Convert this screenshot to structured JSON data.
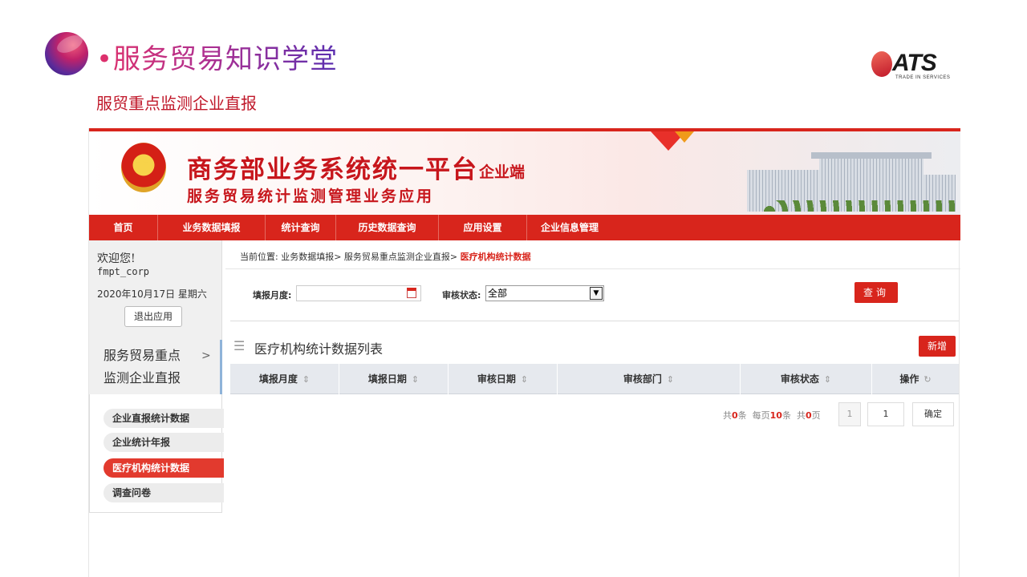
{
  "slide": {
    "title": "•服务贸易知识学堂",
    "subtitle": "服贸重点监测企业直报",
    "logo_text": "ATS",
    "logo_tagline": "TRADE IN SERVICES"
  },
  "banner": {
    "title": "商务部业务系统统一平台",
    "side_label": "企业端",
    "subtitle": "服务贸易统计监测管理业务应用"
  },
  "nav": {
    "items": [
      {
        "label": "首页"
      },
      {
        "label": "业务数据填报"
      },
      {
        "label": "统计查询"
      },
      {
        "label": "历史数据查询"
      },
      {
        "label": "应用设置"
      },
      {
        "label": "企业信息管理"
      }
    ]
  },
  "sidebar": {
    "welcome": "欢迎您!",
    "username": "fmpt_corp",
    "date": "2020年10月17日 星期六",
    "logout_label": "退出应用",
    "module_label": "服务贸易重点监测企业直报",
    "menu": [
      {
        "label": "企业直报统计数据",
        "active": false
      },
      {
        "label": "企业统计年报",
        "active": false
      },
      {
        "label": "医疗机构统计数据",
        "active": true
      },
      {
        "label": "调查问卷",
        "active": false
      }
    ]
  },
  "breadcrumb": {
    "prefix": "当前位置: 业务数据填报> 服务贸易重点监测企业直报>",
    "current": "医疗机构统计数据"
  },
  "filters": {
    "month_label": "填报月度:",
    "month_value": "",
    "status_label": "审核状态:",
    "status_value": "全部",
    "query_label": "查询"
  },
  "list": {
    "title": "医疗机构统计数据列表",
    "add_label": "新增",
    "columns": [
      {
        "label": "填报月度"
      },
      {
        "label": "填报日期"
      },
      {
        "label": "审核日期"
      },
      {
        "label": "审核部门"
      },
      {
        "label": "审核状态"
      },
      {
        "label": "操作"
      }
    ]
  },
  "pager": {
    "total_prefix": "共",
    "total": "0",
    "total_unit": "条",
    "per_page_prefix": "每页",
    "per_page": "10",
    "per_page_unit": "条",
    "pages_prefix": "共",
    "pages": "0",
    "pages_unit": "页",
    "current_page": "1",
    "jump_value": "1",
    "confirm_label": "确定"
  },
  "colors": {
    "accent": "#d8251c",
    "title_gradient_start": "#e0306a",
    "title_gradient_end": "#5a2fb0"
  }
}
